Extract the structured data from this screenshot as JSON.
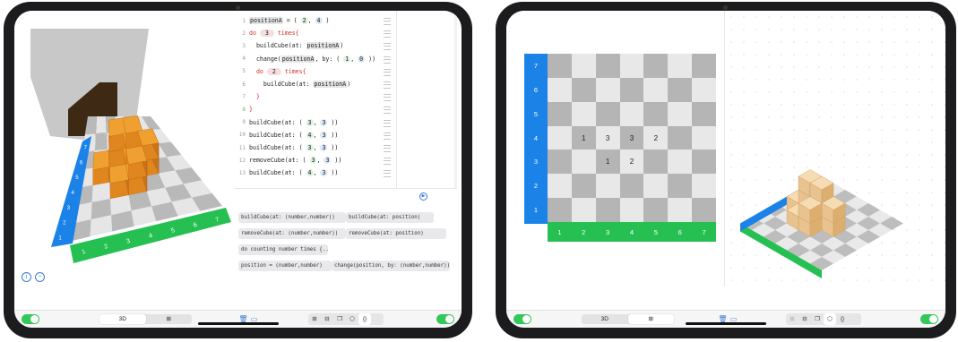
{
  "left_tablet": {
    "code_lines": [
      {
        "num": "1",
        "parts": [
          [
            "tok",
            "positionA"
          ],
          [
            "t",
            " = ( "
          ],
          [
            "num",
            "2"
          ],
          [
            "t",
            ", "
          ],
          [
            "num2",
            "4"
          ],
          [
            "t",
            " )"
          ]
        ]
      },
      {
        "num": "2",
        "parts": [
          [
            "kw",
            "do "
          ],
          [
            "numr",
            " 3 "
          ],
          [
            "kw",
            " times{"
          ]
        ]
      },
      {
        "num": "3",
        "parts": [
          [
            "t",
            "  buildCube(at: "
          ],
          [
            "tok",
            "positionA"
          ],
          [
            "t",
            ")"
          ]
        ]
      },
      {
        "num": "4",
        "parts": [
          [
            "t",
            "  change("
          ],
          [
            "tok",
            "positionA"
          ],
          [
            "t",
            ", by: ( "
          ],
          [
            "num",
            "1"
          ],
          [
            "t",
            ", "
          ],
          [
            "num2",
            "0"
          ],
          [
            "t",
            " ))"
          ]
        ]
      },
      {
        "num": "5",
        "parts": [
          [
            "kw",
            "  do "
          ],
          [
            "numr",
            " 2 "
          ],
          [
            "kw",
            " times{"
          ]
        ]
      },
      {
        "num": "6",
        "parts": [
          [
            "t",
            "    buildCube(at: "
          ],
          [
            "tok",
            "positionA"
          ],
          [
            "t",
            ")"
          ]
        ]
      },
      {
        "num": "7",
        "parts": [
          [
            "kw",
            "  }"
          ]
        ]
      },
      {
        "num": "8",
        "parts": [
          [
            "kw",
            "}"
          ]
        ]
      },
      {
        "num": "9",
        "parts": [
          [
            "t",
            "buildCube(at: ( "
          ],
          [
            "num",
            "3"
          ],
          [
            "t",
            ", "
          ],
          [
            "num2",
            "3"
          ],
          [
            "t",
            " ))"
          ]
        ]
      },
      {
        "num": "10",
        "parts": [
          [
            "t",
            "buildCube(at: ( "
          ],
          [
            "num",
            "4"
          ],
          [
            "t",
            ", "
          ],
          [
            "num2",
            "3"
          ],
          [
            "t",
            " ))"
          ]
        ]
      },
      {
        "num": "11",
        "parts": [
          [
            "t",
            "buildCube(at: ( "
          ],
          [
            "num",
            "3"
          ],
          [
            "t",
            ", "
          ],
          [
            "num2",
            "3"
          ],
          [
            "t",
            " ))"
          ]
        ]
      },
      {
        "num": "12",
        "parts": [
          [
            "t",
            "removeCube(at: ( "
          ],
          [
            "num",
            "3"
          ],
          [
            "t",
            ", "
          ],
          [
            "num2",
            "3"
          ],
          [
            "t",
            " ))"
          ]
        ]
      },
      {
        "num": "13",
        "parts": [
          [
            "t",
            "buildCube(at: ( "
          ],
          [
            "num",
            "4"
          ],
          [
            "t",
            ", "
          ],
          [
            "num2",
            "3"
          ],
          [
            "t",
            " ))"
          ]
        ]
      }
    ],
    "palette": [
      "buildCube(at: (number,number))",
      "buildCube(at: position)",
      "removeCube(at: (number,number))",
      "removeCube(at: position)",
      "do counting number times {...}",
      "position = (number,number)",
      "change(position, by: (number,number))"
    ],
    "x_axis_labels": [
      "1",
      "2",
      "3",
      "4",
      "5",
      "6",
      "7"
    ],
    "y_axis_labels": [
      "1",
      "2",
      "3",
      "4",
      "5",
      "6",
      "7"
    ],
    "toolbar": {
      "view_3d": "3D",
      "view_grid": "⊞",
      "trash_icon": "trash-icon",
      "folder_icon": "folder-icon",
      "code_btn": "{}"
    }
  },
  "right_tablet": {
    "y_axis_labels": [
      "7",
      "6",
      "5",
      "4",
      "3",
      "2",
      "1"
    ],
    "x_axis_labels": [
      "1",
      "2",
      "3",
      "4",
      "5",
      "6",
      "7"
    ],
    "cube_counts": [
      {
        "col": 2,
        "row": 4,
        "value": "1"
      },
      {
        "col": 3,
        "row": 4,
        "value": "3"
      },
      {
        "col": 4,
        "row": 4,
        "value": "3"
      },
      {
        "col": 5,
        "row": 4,
        "value": "2"
      },
      {
        "col": 3,
        "row": 3,
        "value": "1"
      },
      {
        "col": 4,
        "row": 3,
        "value": "2"
      }
    ],
    "toolbar": {
      "view_3d": "3D",
      "view_grid": "⊞",
      "code_btn": "{}"
    }
  },
  "colors": {
    "x_axis": "#25c051",
    "y_axis": "#1b82e8",
    "cube": "#f0a030",
    "toggle": "#34c759"
  }
}
